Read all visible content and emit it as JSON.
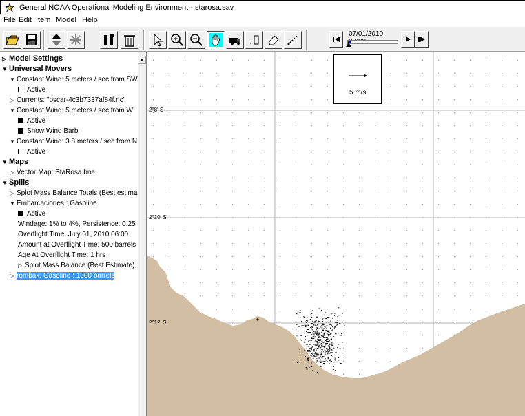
{
  "window": {
    "title": "General NOAA Operational Modeling Environment - starosa.sav"
  },
  "menu": {
    "items": [
      {
        "label": "File"
      },
      {
        "label": "Edit"
      },
      {
        "label": "Item"
      },
      {
        "label": "Model"
      },
      {
        "label": "Help"
      }
    ]
  },
  "toolbar": {
    "buttons": [
      "open-icon",
      "save-icon",
      "move-up-down-icon",
      "spill-icon",
      "tools-icon",
      "trash-icon",
      "arrow-icon",
      "zoom-in-icon",
      "zoom-out-icon",
      "hand-icon",
      "truck-icon",
      "count-icon",
      "eraser-icon",
      "measure-icon"
    ],
    "active_tool": "hand-icon"
  },
  "time_control": {
    "time": "07/01/2010 07:00",
    "progress": 0.06
  },
  "tree": {
    "model_settings": "Model Settings",
    "universal_movers": "Universal Movers",
    "wind1": "Constant Wind: 5 meters / sec from SW",
    "wind1_active": "Active",
    "currents": "Currents: \"oscar-4c3b7337af84f.nc\"",
    "wind2": "Constant Wind: 5 meters / sec from W",
    "wind2_active": "Active",
    "wind2_barb": "Show Wind Barb",
    "wind3": "Constant Wind: 3.8 meters / sec from N",
    "wind3_active": "Active",
    "maps": "Maps",
    "vector_map": "Vector Map: StaRosa.bna",
    "spills": "Spills",
    "splot_totals": "Splot Mass Balance Totals (Best estimate)",
    "embarcaciones": "Embarcaciones : Gasoline",
    "emb_active": "Active",
    "windage": "Windage: 1% to 4%, Persistence: 0.25",
    "overflight": "Overflight Time: July 01, 2010 06:00",
    "amount": "Amount at Overflight Time:  500 barrels",
    "age": "Age At Overflight Time: 1 hrs",
    "splot_best": "Splot Mass Balance (Best Estimate)",
    "rombak": "rombak: Gasoline : 1000 barrels"
  },
  "map": {
    "lat_labels": [
      "2°8' S",
      "2°10' S",
      "2°12' S"
    ],
    "legend_speed": "5 m/s",
    "land_color": "#d2bfa3"
  }
}
